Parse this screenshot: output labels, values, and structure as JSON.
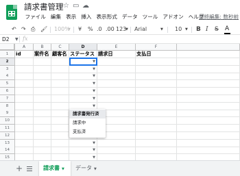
{
  "app": {
    "title": "請求書管理",
    "title_icons": [
      "star-icon",
      "move-to-folder-icon",
      "cloud-status-icon"
    ],
    "brand_color": "#0f9d58"
  },
  "menu": [
    "ファイル",
    "編集",
    "表示",
    "挿入",
    "表示形式",
    "データ",
    "ツール",
    "アドオン",
    "ヘルプ"
  ],
  "last_edit": "最終編集: 数秒前",
  "toolbar": {
    "zoom": "100%",
    "currency": "¥",
    "percent": "%",
    "dec_decrease": ".0",
    "dec_increase": ".00",
    "more_formats": "123",
    "font": "Arial",
    "font_size": "10",
    "bold": "B",
    "italic": "I",
    "strikethrough": "S",
    "text_color": "A"
  },
  "formula_bar": {
    "cell_ref": "D2",
    "fx": "fx",
    "value": ""
  },
  "grid": {
    "columns": [
      "A",
      "B",
      "C",
      "D",
      "E",
      "F"
    ],
    "rows": [
      "1",
      "2",
      "3",
      "4",
      "5",
      "6",
      "7",
      "8",
      "9",
      "10",
      "11",
      "12",
      "13",
      "14",
      "15"
    ],
    "header_row": [
      "id",
      "案件名",
      "顧客名",
      "ステータス",
      "請求日",
      "支払日"
    ],
    "active_cell": "D2",
    "selection_color": "#1a73e8"
  },
  "dropdown": {
    "options": [
      "請求書発行済",
      "請求中",
      "支払済"
    ],
    "highlighted_option": "請求書発行済"
  },
  "sheets": [
    {
      "name": "請求書",
      "active": true
    },
    {
      "name": "データ",
      "active": false
    }
  ]
}
